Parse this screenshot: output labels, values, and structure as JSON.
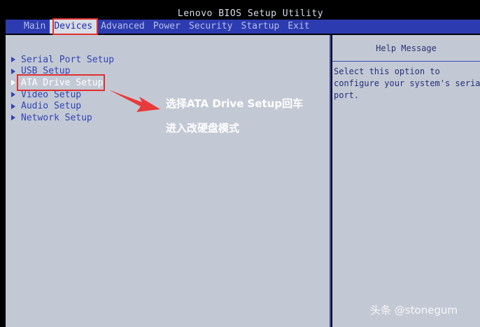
{
  "window": {
    "title": "Lenovo BIOS Setup Utility"
  },
  "menu": {
    "items": [
      {
        "label": "Main"
      },
      {
        "label": "Devices"
      },
      {
        "label": "Advanced"
      },
      {
        "label": "Power"
      },
      {
        "label": "Security"
      },
      {
        "label": "Startup"
      },
      {
        "label": "Exit"
      }
    ],
    "active": "Devices"
  },
  "devices_list": {
    "items": [
      {
        "label": "Serial Port Setup"
      },
      {
        "label": "USB Setup"
      },
      {
        "label": "ATA Drive Setup"
      },
      {
        "label": "Video Setup"
      },
      {
        "label": "Audio Setup"
      },
      {
        "label": "Network Setup"
      }
    ],
    "selected": "ATA Drive Setup"
  },
  "help": {
    "header": "Help Message",
    "text": "Select this option to\nconfigure your system's serial\nport."
  },
  "annotation": {
    "line1": "选择ATA Drive Setup回车",
    "line2": "进入改硬盘模式"
  },
  "watermark": "头条 @stonegum",
  "colors": {
    "menu_bar": "#2d3bb0",
    "panel": "#c3c9d4",
    "list_text": "#3142b8",
    "highlight": "#e03030"
  }
}
